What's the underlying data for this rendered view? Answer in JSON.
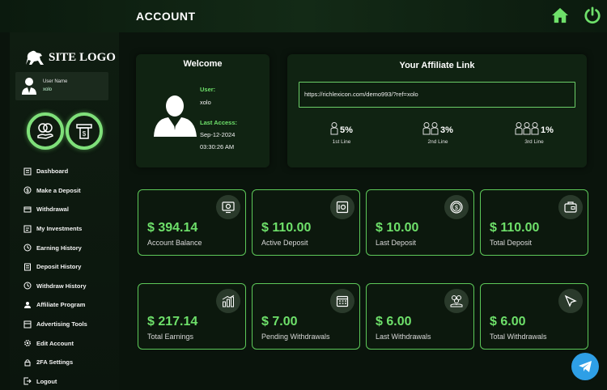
{
  "header": {
    "title": "ACCOUNT",
    "home_icon": "home-icon",
    "power_icon": "power-icon",
    "accent": "#6ee06a"
  },
  "sidebar": {
    "logo_text": "SITE LOGO",
    "user": {
      "label": "User Name",
      "value": "xolo"
    },
    "items": [
      {
        "label": "Dashboard",
        "icon": "dashboard-icon"
      },
      {
        "label": "Make a Deposit",
        "icon": "dollar-icon"
      },
      {
        "label": "Withdrawal",
        "icon": "withdraw-icon"
      },
      {
        "label": "My Investments",
        "icon": "investments-icon"
      },
      {
        "label": "Earning History",
        "icon": "history-icon"
      },
      {
        "label": "Deposit History",
        "icon": "deposit-history-icon"
      },
      {
        "label": "Withdraw History",
        "icon": "history-icon"
      },
      {
        "label": "Affiliate Program",
        "icon": "affiliate-icon"
      },
      {
        "label": "Advertising Tools",
        "icon": "tools-icon"
      },
      {
        "label": "Edit Account",
        "icon": "gear-icon"
      },
      {
        "label": "2FA Settings",
        "icon": "lock-icon"
      },
      {
        "label": "Logout",
        "icon": "logout-icon"
      }
    ]
  },
  "welcome": {
    "title": "Welcome",
    "user_label": "User:",
    "user_value": "xolo",
    "last_access_label": "Last Access:",
    "last_access_date": "Sep-12-2024",
    "last_access_time": "03:30:26 AM"
  },
  "affiliate": {
    "title": "Your Affiliate Link",
    "link": "https://richlexicon.com/demo993/?ref=xolo",
    "levels": [
      {
        "pct": "5%",
        "name": "1st Line"
      },
      {
        "pct": "3%",
        "name": "2nd Line"
      },
      {
        "pct": "1%",
        "name": "3rd Line"
      }
    ]
  },
  "stats": [
    {
      "amount": "$ 394.14",
      "label": "Account Balance",
      "icon": "monitor-icon"
    },
    {
      "amount": "$ 110.00",
      "label": "Active Deposit",
      "icon": "safe-icon"
    },
    {
      "amount": "$ 10.00",
      "label": "Last Deposit",
      "icon": "coin-icon"
    },
    {
      "amount": "$ 110.00",
      "label": "Total Deposit",
      "icon": "wallet-icon"
    },
    {
      "amount": "$ 217.14",
      "label": "Total Earnings",
      "icon": "bar-chart-icon"
    },
    {
      "amount": "$ 7.00",
      "label": "Pending Withdrawals",
      "icon": "calendar-icon"
    },
    {
      "amount": "$ 6.00",
      "label": "Last Withdrawals",
      "icon": "hand-coins-icon"
    },
    {
      "amount": "$ 6.00",
      "label": "Total Withdrawals",
      "icon": "cursor-icon"
    }
  ],
  "telegram_icon": "telegram-icon"
}
